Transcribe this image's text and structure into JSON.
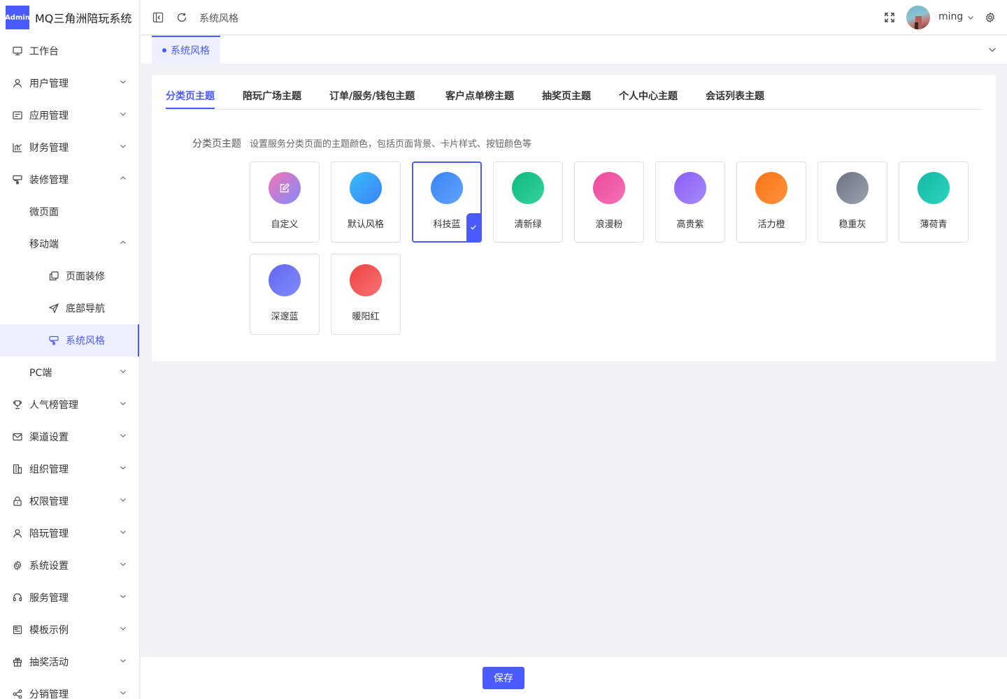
{
  "app": {
    "logo_text": "Admin",
    "title": "MQ三角洲陪玩系统"
  },
  "header": {
    "breadcrumb": "系统风格",
    "user_name": "ming"
  },
  "sidebar": {
    "items": [
      {
        "label": "工作台",
        "icon": "monitor-icon",
        "level": 1,
        "chevron": "none"
      },
      {
        "label": "用户管理",
        "icon": "user-icon",
        "level": 1,
        "chevron": "down"
      },
      {
        "label": "应用管理",
        "icon": "app-card-icon",
        "level": 1,
        "chevron": "down"
      },
      {
        "label": "财务管理",
        "icon": "chart-icon",
        "level": 1,
        "chevron": "down"
      },
      {
        "label": "装修管理",
        "icon": "paint-icon",
        "level": 1,
        "chevron": "up"
      },
      {
        "label": "微页面",
        "icon": "",
        "level": 2,
        "chevron": "none"
      },
      {
        "label": "移动端",
        "icon": "",
        "level": 2,
        "chevron": "up"
      },
      {
        "label": "页面装修",
        "icon": "copy-icon",
        "level": 3,
        "chevron": "none"
      },
      {
        "label": "底部导航",
        "icon": "send-icon",
        "level": 3,
        "chevron": "none"
      },
      {
        "label": "系统风格",
        "icon": "paint-icon",
        "level": 3,
        "chevron": "none",
        "active": true
      },
      {
        "label": "PC端",
        "icon": "",
        "level": 2,
        "chevron": "down"
      },
      {
        "label": "人气榜管理",
        "icon": "trophy-icon",
        "level": 1,
        "chevron": "down"
      },
      {
        "label": "渠道设置",
        "icon": "mail-icon",
        "level": 1,
        "chevron": "down"
      },
      {
        "label": "组织管理",
        "icon": "building-icon",
        "level": 1,
        "chevron": "down"
      },
      {
        "label": "权限管理",
        "icon": "lock-icon",
        "level": 1,
        "chevron": "down"
      },
      {
        "label": "陪玩管理",
        "icon": "user-icon",
        "level": 1,
        "chevron": "down"
      },
      {
        "label": "系统设置",
        "icon": "gear-icon",
        "level": 1,
        "chevron": "down"
      },
      {
        "label": "服务管理",
        "icon": "headset-icon",
        "level": 1,
        "chevron": "down"
      },
      {
        "label": "模板示例",
        "icon": "template-icon",
        "level": 1,
        "chevron": "down"
      },
      {
        "label": "抽奖活动",
        "icon": "gift-icon",
        "level": 1,
        "chevron": "down"
      },
      {
        "label": "分销管理",
        "icon": "share-icon",
        "level": 1,
        "chevron": "down"
      }
    ]
  },
  "page_tabs": [
    {
      "label": "系统风格"
    }
  ],
  "theme_tabs": [
    {
      "label": "分类页主题",
      "active": true
    },
    {
      "label": "陪玩广场主题"
    },
    {
      "label": "订单/服务/钱包主题"
    },
    {
      "label": "客户点单榜主题"
    },
    {
      "label": "抽奖页主题"
    },
    {
      "label": "个人中心主题"
    },
    {
      "label": "会话列表主题"
    }
  ],
  "form": {
    "label": "分类页主题",
    "description": "设置服务分类页面的主题颜色，包括页面背景、卡片样式、按钮颜色等"
  },
  "themes": [
    {
      "label": "自定义",
      "colors": [
        "#f472b6",
        "#818cf8"
      ],
      "icon": "edit-icon"
    },
    {
      "label": "默认风格",
      "colors": [
        "#38bdf8",
        "#3b82f6"
      ]
    },
    {
      "label": "科技蓝",
      "colors": [
        "#3b82f6",
        "#60a5fa"
      ],
      "selected": true
    },
    {
      "label": "清新绿",
      "colors": [
        "#10b981",
        "#34d399"
      ]
    },
    {
      "label": "浪漫粉",
      "colors": [
        "#ec4899",
        "#f472b6"
      ]
    },
    {
      "label": "高贵紫",
      "colors": [
        "#8b5cf6",
        "#a78bfa"
      ]
    },
    {
      "label": "活力橙",
      "colors": [
        "#f97316",
        "#fb923c"
      ]
    },
    {
      "label": "稳重灰",
      "colors": [
        "#6b7280",
        "#9ca3af"
      ]
    },
    {
      "label": "薄荷青",
      "colors": [
        "#14b8a6",
        "#2dd4bf"
      ]
    },
    {
      "label": "深邃蓝",
      "colors": [
        "#6366f1",
        "#818cf8"
      ]
    },
    {
      "label": "暖阳红",
      "colors": [
        "#ef4444",
        "#f87171"
      ]
    }
  ],
  "footer": {
    "save_label": "保存"
  },
  "colors": {
    "accent": "#4a5cff"
  }
}
